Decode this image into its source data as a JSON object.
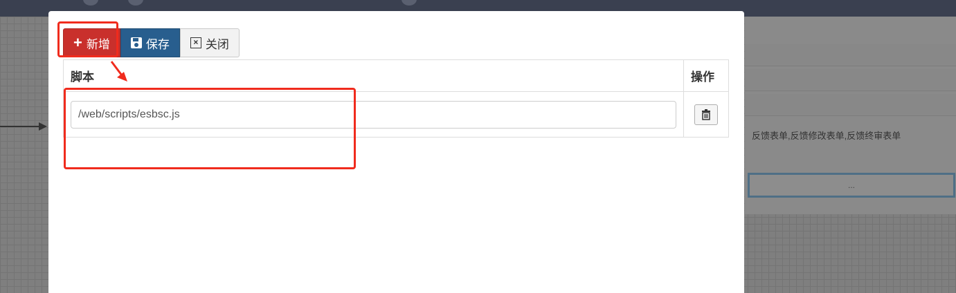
{
  "toolbar": {
    "add_label": "新增",
    "save_label": "保存",
    "close_label": "关闭"
  },
  "table": {
    "headers": {
      "script": "脚本",
      "action": "操作"
    },
    "rows": [
      {
        "script_value": "/web/scripts/esbsc.js",
        "action_icon": "trash-icon"
      }
    ]
  },
  "background": {
    "right_panel_text": "反馈表单,反馈修改表单,反馈终审表单",
    "right_panel_field": "..."
  },
  "colors": {
    "add_button": "#c9302c",
    "save_button": "#285e8e",
    "annotation": "#f02b1d"
  }
}
